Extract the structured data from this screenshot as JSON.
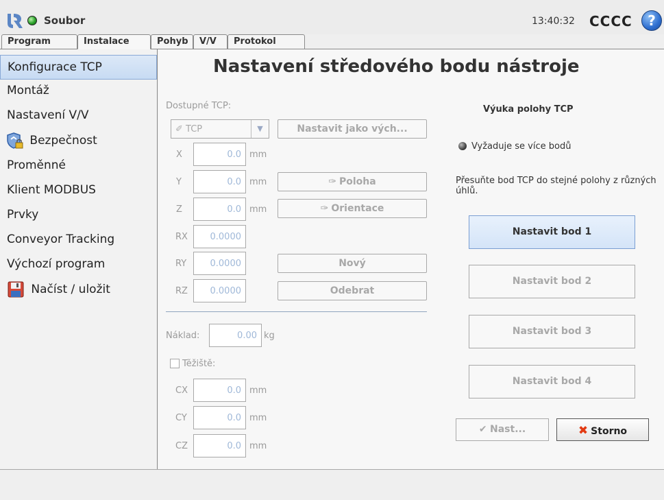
{
  "header": {
    "file_menu": "Soubor",
    "time": "13:40:32",
    "robot_name": "CCCC",
    "help": "?"
  },
  "tabs": [
    {
      "label": "Program",
      "active": false
    },
    {
      "label": "Instalace",
      "active": true
    },
    {
      "label": "Pohyb",
      "active": false
    },
    {
      "label": "V/V",
      "active": false
    },
    {
      "label": "Protokol",
      "active": false
    }
  ],
  "sidebar": {
    "items": [
      {
        "label": "Konfigurace TCP",
        "selected": true
      },
      {
        "label": "Montáž"
      },
      {
        "label": "Nastavení V/V"
      },
      {
        "label": "Bezpečnost",
        "icon": "shield-lock-icon"
      },
      {
        "label": "Proměnné"
      },
      {
        "label": "Klient MODBUS"
      },
      {
        "label": "Prvky"
      },
      {
        "label": "Conveyor Tracking"
      },
      {
        "label": "Výchozí program"
      },
      {
        "label": "Načíst / uložit",
        "icon": "floppy-disk-icon"
      }
    ]
  },
  "main": {
    "title": "Nastavení středového bodu nástroje",
    "available_tcp_label": "Dostupné TCP:",
    "tcp_selected": "TCP",
    "set_default_button": "Nastavit jako vých...",
    "fields": {
      "x": {
        "label": "X",
        "value": "0.0",
        "unit": "mm"
      },
      "y": {
        "label": "Y",
        "value": "0.0",
        "unit": "mm"
      },
      "z": {
        "label": "Z",
        "value": "0.0",
        "unit": "mm"
      },
      "rx": {
        "label": "RX",
        "value": "0.0000"
      },
      "ry": {
        "label": "RY",
        "value": "0.0000"
      },
      "rz": {
        "label": "RZ",
        "value": "0.0000"
      }
    },
    "position_button": "Poloha",
    "orientation_button": "Orientace",
    "new_button": "Nový",
    "remove_button": "Odebrat",
    "payload": {
      "label": "Náklad:",
      "value": "0.00",
      "unit": "kg"
    },
    "cog": {
      "label": "Těžiště:",
      "checked": false,
      "cx": {
        "label": "CX",
        "value": "0.0",
        "unit": "mm"
      },
      "cy": {
        "label": "CY",
        "value": "0.0",
        "unit": "mm"
      },
      "cz": {
        "label": "CZ",
        "value": "0.0",
        "unit": "mm"
      }
    }
  },
  "teach": {
    "title": "Výuka polohy TCP",
    "status": "Vyžaduje se více bodů",
    "instructions": "Přesuňte bod TCP do stejné polohy z různých úhlů.",
    "points": [
      "Nastavit bod 1",
      "Nastavit bod 2",
      "Nastavit bod 3",
      "Nastavit bod 4"
    ],
    "set_button": "Nast...",
    "cancel_button": "Storno"
  },
  "colors": {
    "accent": "#3b6fb6",
    "selection": "#c7dbf3",
    "status_ok": "#2aa02a",
    "cancel_x": "#e23a12"
  }
}
